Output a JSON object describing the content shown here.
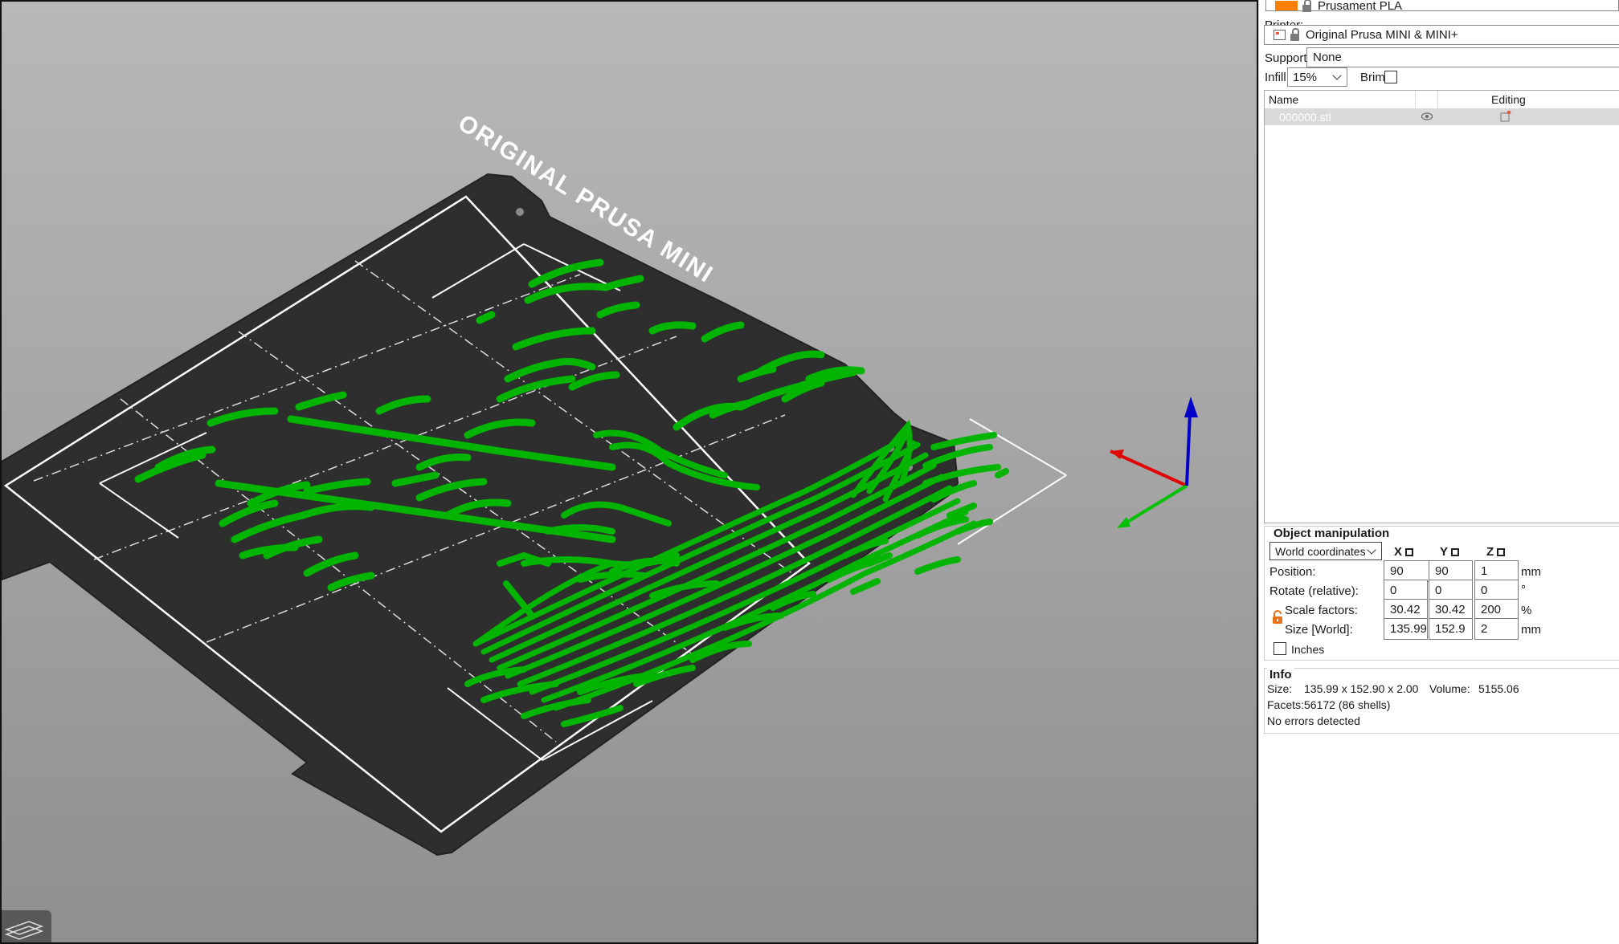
{
  "filament": {
    "value": "Prusament PLA",
    "swatch_color": "#ff7f00"
  },
  "printer": {
    "label": "Printer:",
    "value": "Original Prusa MINI & MINI+"
  },
  "supports": {
    "label": "Supports:",
    "value": "None"
  },
  "infill": {
    "label": "Infill:",
    "value": "15%"
  },
  "brim": {
    "label": "Brim:",
    "checked": false
  },
  "object_list": {
    "columns": {
      "name": "Name",
      "editing": "Editing"
    },
    "items": [
      {
        "name": "000000.stl",
        "visible_icon": "eye-icon",
        "edit_icon": "edit-part-icon"
      }
    ]
  },
  "object_manipulation": {
    "title": "Object manipulation",
    "coordinates": "World coordinates",
    "axes": [
      "X",
      "Y",
      "Z"
    ],
    "rows": [
      {
        "label": "Position:",
        "values": [
          "90",
          "90",
          "1"
        ],
        "unit": "mm"
      },
      {
        "label": "Rotate (relative):",
        "values": [
          "0",
          "0",
          "0"
        ],
        "unit": "°"
      },
      {
        "label": "Scale factors:",
        "values": [
          "30.42",
          "30.42",
          "200"
        ],
        "unit": "%"
      },
      {
        "label": "Size [World]:",
        "values": [
          "135.99",
          "152.9",
          "2"
        ],
        "unit": "mm"
      }
    ],
    "inches_label": "Inches"
  },
  "info": {
    "title": "Info",
    "size_label": "Size:",
    "size_value": "135.99 x 152.90 x 2.00",
    "volume_label": "Volume:",
    "volume_value": "5155.06",
    "facets_label": "Facets:",
    "facets_value": "56172 (86 shells)",
    "errors": "No errors detected"
  },
  "viewport": {
    "bed_text": "ORIGINAL PRUSA MINI",
    "model_color": "#00b400",
    "bed_color": "#2e2e2e",
    "axis_colors": {
      "x": "#e00000",
      "y": "#00c000",
      "z": "#0000c8"
    }
  }
}
